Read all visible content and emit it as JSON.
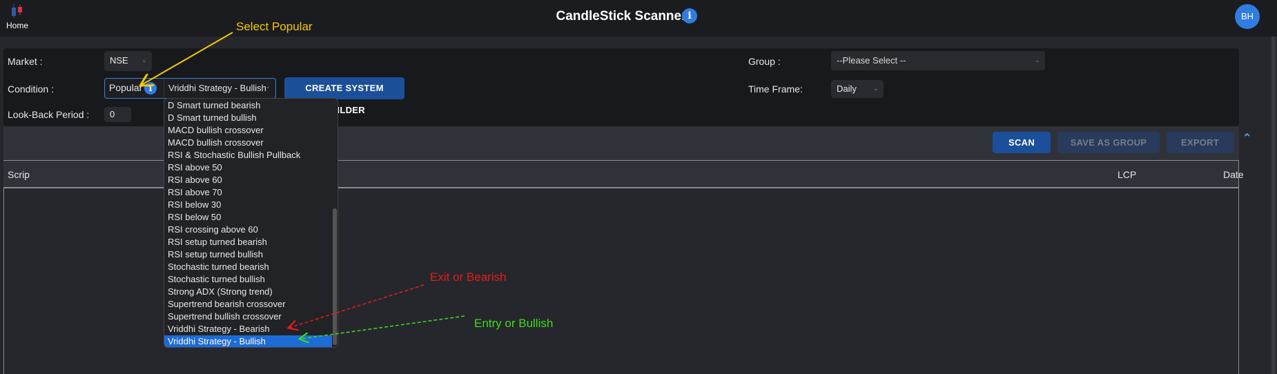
{
  "header": {
    "home_label": "Home",
    "title": "CandleStick Scanner",
    "info_icon": "i",
    "avatar_initials": "BH"
  },
  "form": {
    "market_label": "Market :",
    "market_value": "NSE",
    "condition_label": "Condition :",
    "condition_category": "Popular",
    "condition_value": "Vriddhi Strategy - Bullish",
    "create_builder_label": "CREATE SYSTEM BUILDER",
    "lookback_label": "Look-Back Period :",
    "lookback_value": "0",
    "group_label": "Group :",
    "group_placeholder": "--Please Select --",
    "timeframe_label": "Time Frame:",
    "timeframe_value": "Daily"
  },
  "toolbar": {
    "scan_label": "SCAN",
    "save_group_label": "SAVE AS GROUP",
    "export_label": "EXPORT"
  },
  "table": {
    "columns": [
      "Scrip",
      "LCP",
      "Date"
    ]
  },
  "dropdown": {
    "options": [
      "D Smart turned bearish",
      "D Smart turned bullish",
      "MACD bullish crossover",
      "MACD bullish crossover",
      "RSI & Stochastic Bullish Pullback",
      "RSI above 50",
      "RSI above 60",
      "RSI above 70",
      "RSI below 30",
      "RSI below 50",
      "RSI crossing above 60",
      "RSI setup turned bearish",
      "RSI setup turned bullish",
      "Stochastic turned bearish",
      "Stochastic turned bullish",
      "Strong ADX (Strong trend)",
      "Supertrend bearish crossover",
      "Supertrend bullish crossover",
      "Vriddhi Strategy - Bearish",
      "Vriddhi Strategy - Bullish"
    ],
    "selected": "Vriddhi Strategy - Bullish"
  },
  "annotations": {
    "select_popular": "Select Popular",
    "exit_bearish": "Exit or Bearish",
    "entry_bullish": "Entry or Bullish"
  },
  "colors": {
    "accent": "#2f7de1",
    "button": "#1c4f9a",
    "selected_option": "#1d6bd6",
    "annotation_yellow": "#f5c800",
    "annotation_red": "#e51c1c",
    "annotation_green": "#3ddc1a"
  }
}
